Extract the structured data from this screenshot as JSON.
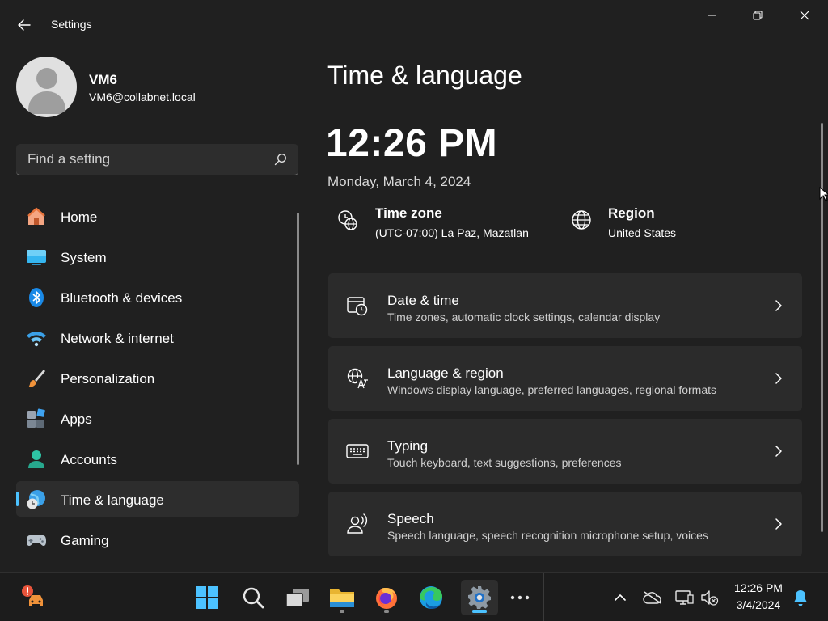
{
  "window": {
    "title": "Settings",
    "controls": {
      "minimize": "minimize",
      "maximize": "restore",
      "close": "close"
    }
  },
  "profile": {
    "name": "VM6",
    "email": "VM6@collabnet.local"
  },
  "search": {
    "placeholder": "Find a setting"
  },
  "sidebar": {
    "items": [
      {
        "label": "Home",
        "icon": "home-icon",
        "active": false
      },
      {
        "label": "System",
        "icon": "system-icon",
        "active": false
      },
      {
        "label": "Bluetooth & devices",
        "icon": "bluetooth-icon",
        "active": false
      },
      {
        "label": "Network & internet",
        "icon": "wifi-icon",
        "active": false
      },
      {
        "label": "Personalization",
        "icon": "brush-icon",
        "active": false
      },
      {
        "label": "Apps",
        "icon": "apps-icon",
        "active": false
      },
      {
        "label": "Accounts",
        "icon": "accounts-icon",
        "active": false
      },
      {
        "label": "Time & language",
        "icon": "time-language-icon",
        "active": true
      },
      {
        "label": "Gaming",
        "icon": "gaming-icon",
        "active": false
      }
    ]
  },
  "main": {
    "title": "Time & language",
    "clock": "12:26 PM",
    "date": "Monday, March 4, 2024",
    "time_zone": {
      "title": "Time zone",
      "value": "(UTC-07:00) La Paz, Mazatlan",
      "icon": "timezone-globe-icon"
    },
    "region": {
      "title": "Region",
      "value": "United States",
      "icon": "globe-icon"
    },
    "cards": [
      {
        "title": "Date & time",
        "description": "Time zones, automatic clock settings, calendar display",
        "icon": "calendar-clock-icon"
      },
      {
        "title": "Language & region",
        "description": "Windows display language, preferred languages, regional formats",
        "icon": "language-icon"
      },
      {
        "title": "Typing",
        "description": "Touch keyboard, text suggestions, preferences",
        "icon": "keyboard-icon"
      },
      {
        "title": "Speech",
        "description": "Speech language, speech recognition microphone setup, voices",
        "icon": "speech-icon"
      }
    ]
  },
  "taskbar": {
    "apps": [
      {
        "name": "start",
        "icon": "windows-logo-icon"
      },
      {
        "name": "search",
        "icon": "search-icon"
      },
      {
        "name": "task-view",
        "icon": "task-view-icon"
      },
      {
        "name": "file-explorer",
        "icon": "folder-icon"
      },
      {
        "name": "firefox",
        "icon": "firefox-icon"
      },
      {
        "name": "edge",
        "icon": "edge-icon"
      },
      {
        "name": "settings",
        "icon": "gear-icon"
      },
      {
        "name": "more",
        "icon": "ellipsis-icon"
      }
    ],
    "tray": {
      "time": "12:26 PM",
      "date": "3/4/2024"
    }
  },
  "colors": {
    "background": "#202020",
    "card": "#2b2b2b",
    "accent": "#4cc2ff",
    "taskbar": "#1c1c1c"
  }
}
